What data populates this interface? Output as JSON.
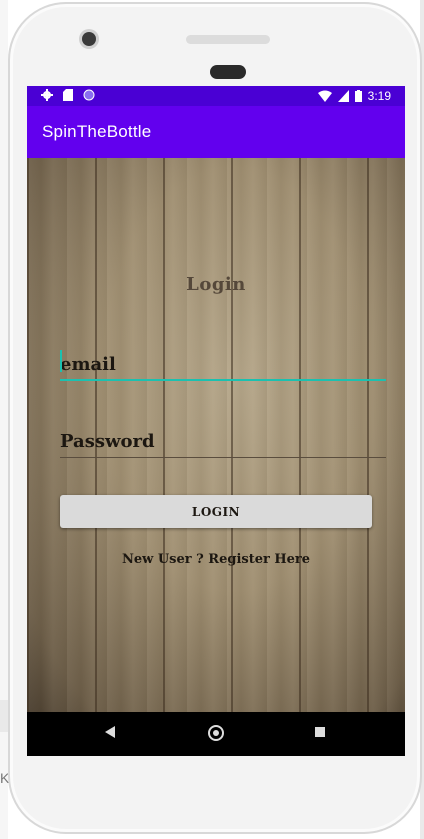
{
  "status_bar": {
    "time": "3:19",
    "icons": [
      "gear-icon",
      "sd-card-icon",
      "circle-icon",
      "wifi-icon",
      "signal-icon",
      "battery-icon"
    ]
  },
  "app_bar": {
    "title": "SpinTheBottle"
  },
  "login": {
    "title": "Login",
    "email_placeholder": "email",
    "password_placeholder": "Password",
    "button_label": "LOGIN",
    "register_text": "New User ? Register Here"
  },
  "nav_bar": {
    "icons": [
      "back-icon",
      "home-icon",
      "recents-icon"
    ]
  },
  "colors": {
    "status_bar": "#4a00d4",
    "app_bar": "#6200ee",
    "accent": "#1bc1b0",
    "button": "#dadada"
  },
  "side_text": "K"
}
